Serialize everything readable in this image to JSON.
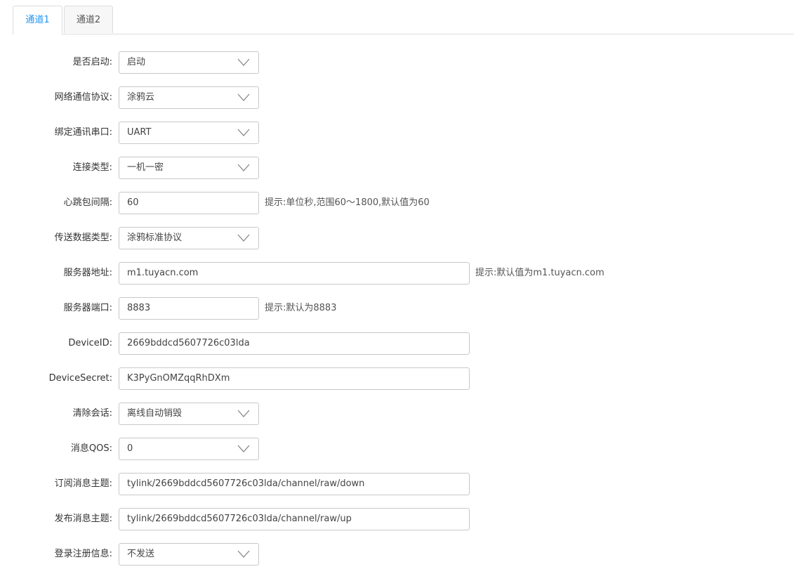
{
  "tabs": [
    {
      "label": "通道1",
      "active": true
    },
    {
      "label": "通道2",
      "active": false
    }
  ],
  "form": {
    "enabled": {
      "label": "是否启动:",
      "value": "启动"
    },
    "protocol": {
      "label": "网络通信协议:",
      "value": "涂鸦云"
    },
    "serial_port": {
      "label": "绑定通讯串口:",
      "value": "UART"
    },
    "conn_type": {
      "label": "连接类型:",
      "value": "一机一密"
    },
    "heartbeat": {
      "label": "心跳包间隔:",
      "value": "60",
      "hint": "提示:单位秒,范围60～1800,默认值为60"
    },
    "data_type": {
      "label": "传送数据类型:",
      "value": "涂鸦标准协议"
    },
    "server_addr": {
      "label": "服务器地址:",
      "value": "m1.tuyacn.com",
      "hint": "提示:默认值为m1.tuyacn.com"
    },
    "server_port": {
      "label": "服务器端口:",
      "value": "8883",
      "hint": "提示:默认为8883"
    },
    "device_id": {
      "label": "DeviceID:",
      "value": "2669bddcd5607726c03lda"
    },
    "device_secret": {
      "label": "DeviceSecret:",
      "value": "K3PyGnOMZqqRhDXm"
    },
    "clean_session": {
      "label": "清除会话:",
      "value": "离线自动销毁"
    },
    "qos": {
      "label": "消息QOS:",
      "value": "0"
    },
    "sub_topic": {
      "label": "订阅消息主题:",
      "value": "tylink/2669bddcd5607726c03lda/channel/raw/down"
    },
    "pub_topic": {
      "label": "发布消息主题:",
      "value": "tylink/2669bddcd5607726c03lda/channel/raw/up"
    },
    "login_info": {
      "label": "登录注册信息:",
      "value": "不发送"
    }
  },
  "colors": {
    "active_tab": "#2196f3",
    "border": "#c8c8c8"
  }
}
